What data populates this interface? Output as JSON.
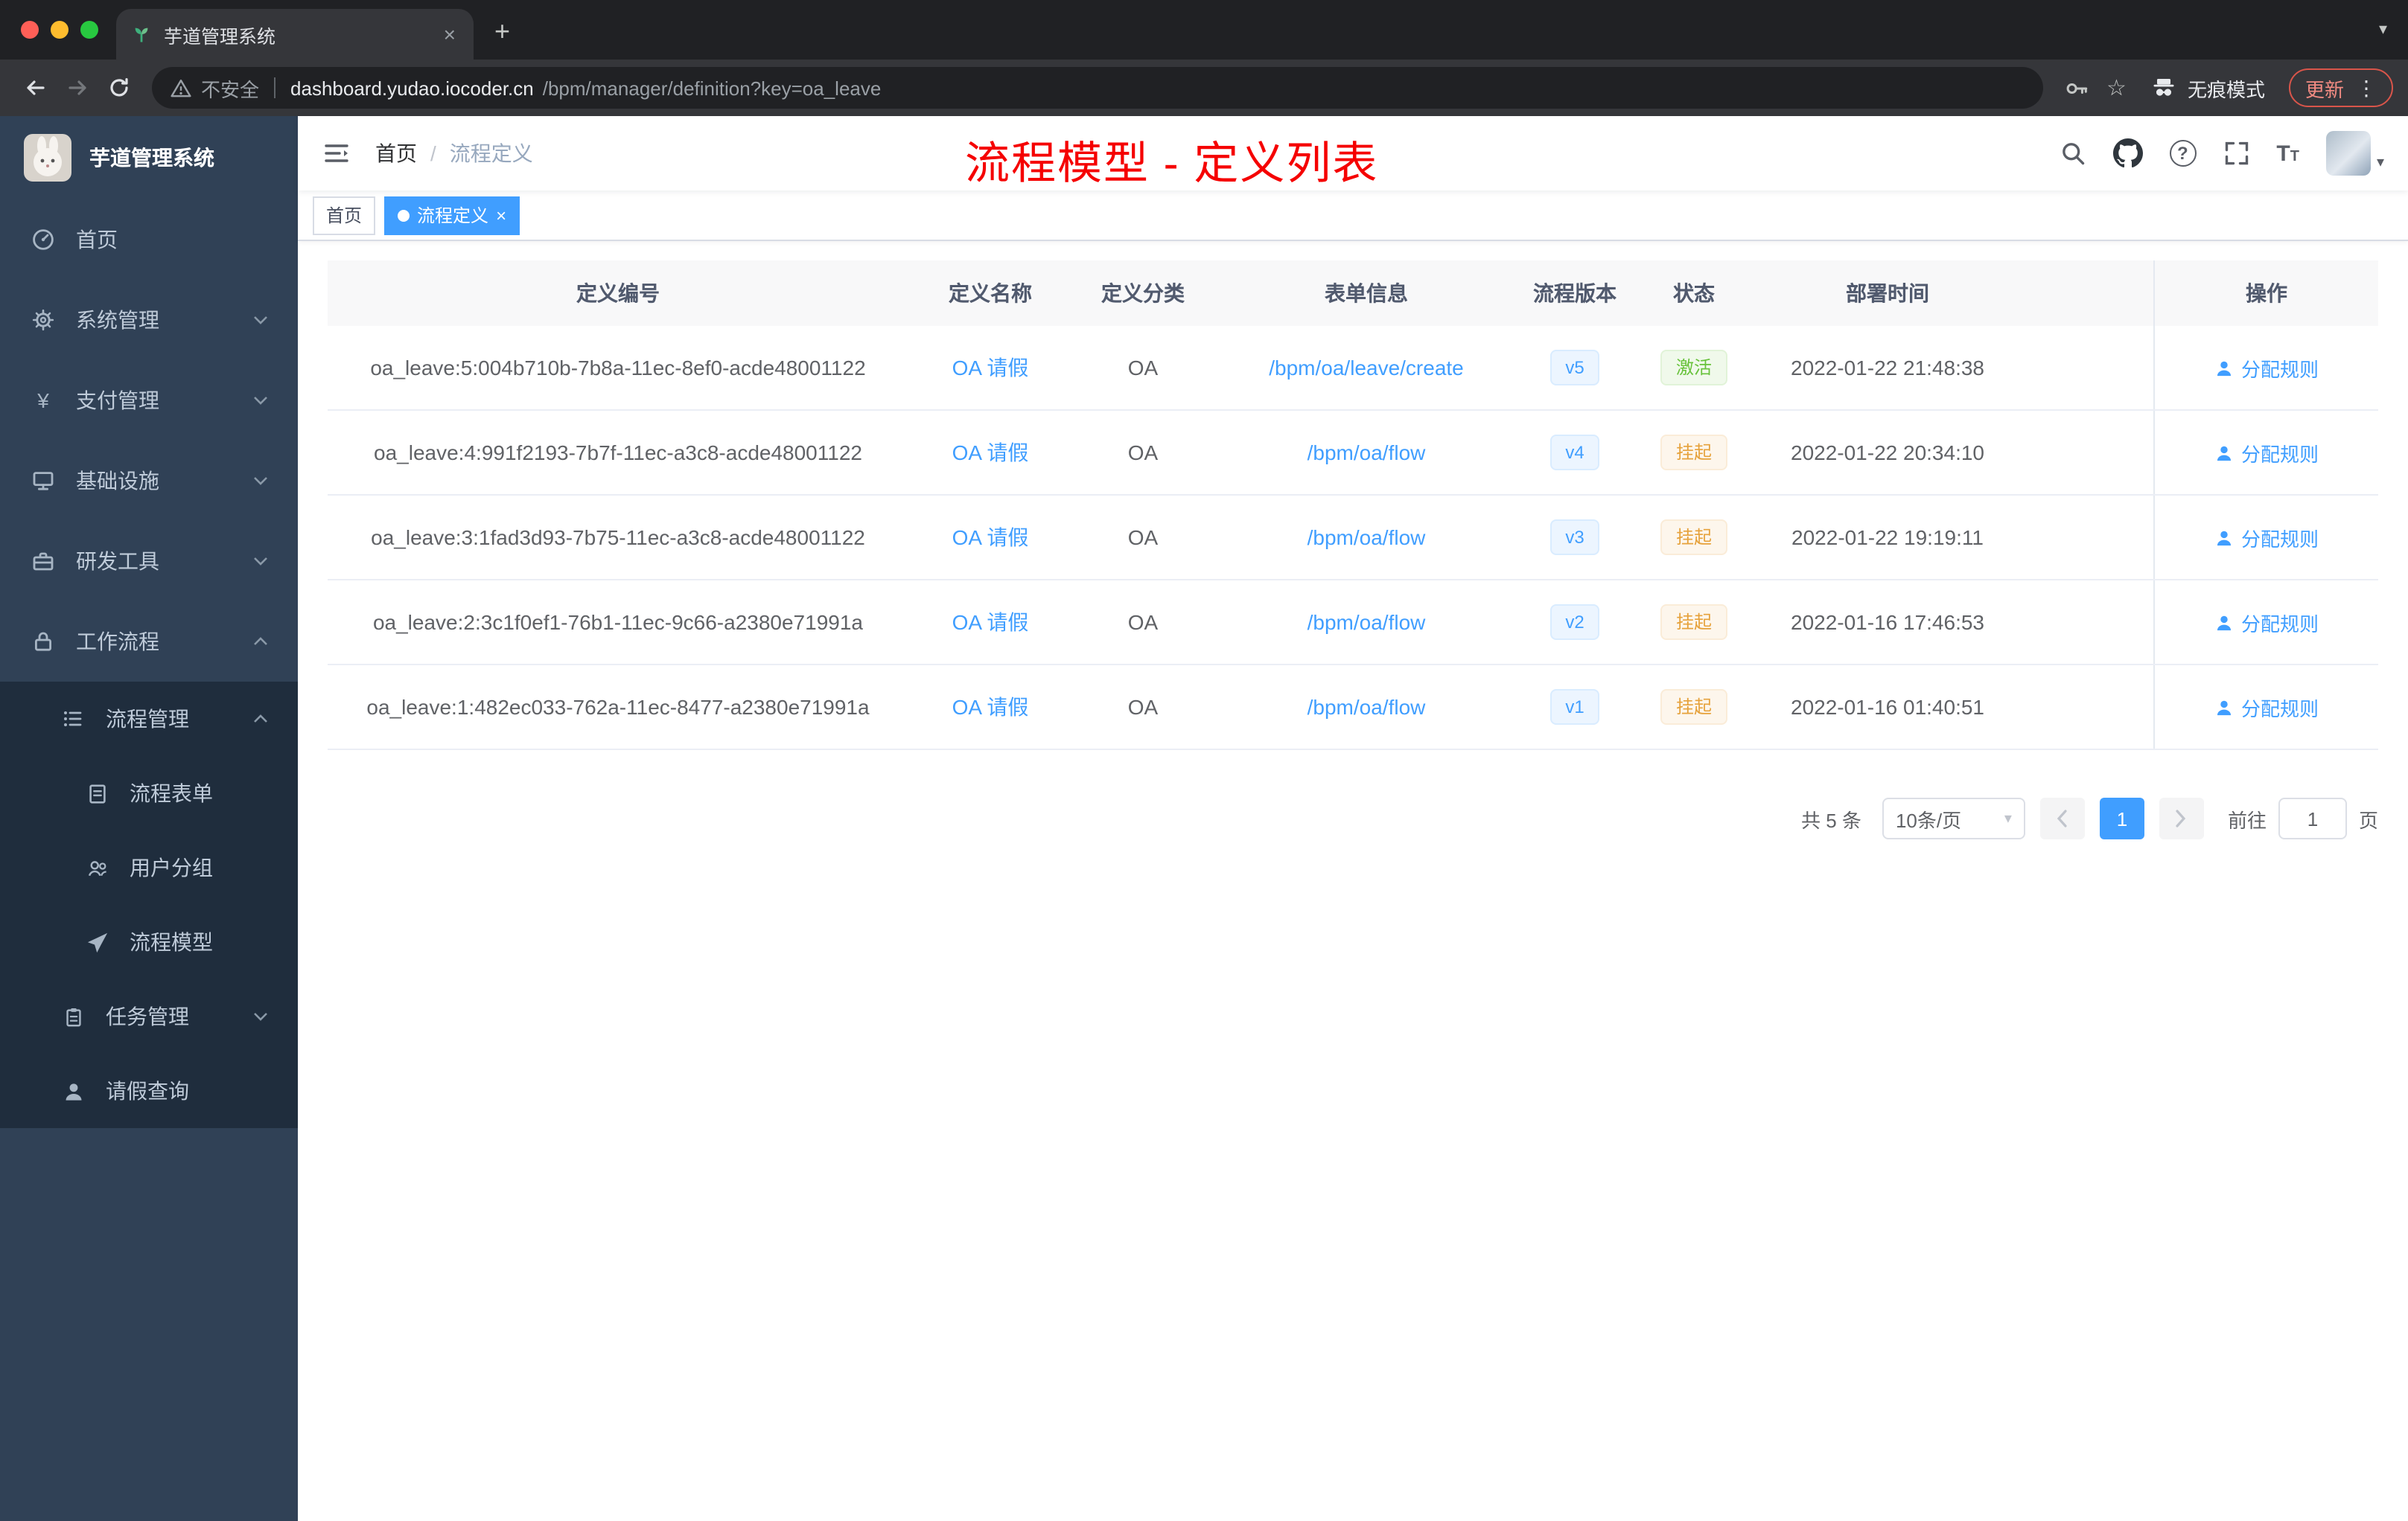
{
  "browser": {
    "tab_title": "芋道管理系统",
    "address": {
      "security_label": "不安全",
      "domain": "dashboard.yudao.iocoder.cn",
      "path": "/bpm/manager/definition?key=oa_leave"
    },
    "incognito_label": "无痕模式",
    "update_label": "更新"
  },
  "icons": {
    "new_tab": "+",
    "close_tab": "×",
    "tab_search": "▾",
    "star": "☆",
    "menu_dots": "⋮",
    "caret_down": "▾",
    "yen": "¥",
    "help": "?",
    "font_big": "T",
    "font_small": "T",
    "tag_close": "×"
  },
  "sidebar": {
    "logo_title": "芋道管理系统",
    "items": [
      {
        "label": "首页",
        "icon": "dashboard-icon"
      },
      {
        "label": "系统管理",
        "icon": "gear-icon",
        "state": "collapsed"
      },
      {
        "label": "支付管理",
        "icon": "yen-icon",
        "state": "collapsed"
      },
      {
        "label": "基础设施",
        "icon": "infrastructure-icon",
        "state": "collapsed"
      },
      {
        "label": "研发工具",
        "icon": "devtools-icon",
        "state": "collapsed"
      },
      {
        "label": "工作流程",
        "icon": "workflow-icon",
        "state": "expanded",
        "children": [
          {
            "label": "流程管理",
            "icon": "list-icon",
            "state": "expanded",
            "children": [
              {
                "label": "流程表单",
                "icon": "form-icon"
              },
              {
                "label": "用户分组",
                "icon": "user-group-icon"
              },
              {
                "label": "流程模型",
                "icon": "paper-plane-icon"
              }
            ]
          },
          {
            "label": "任务管理",
            "icon": "tasks-icon",
            "state": "collapsed"
          },
          {
            "label": "请假查询",
            "icon": "person-icon"
          }
        ]
      }
    ]
  },
  "header": {
    "breadcrumb": {
      "items": [
        "首页",
        "流程定义"
      ],
      "separator": "/"
    },
    "annotation": "流程模型 - 定义列表",
    "icons": [
      "search-icon",
      "github-icon",
      "help-icon",
      "fullscreen-icon",
      "font-size-icon",
      "avatar"
    ]
  },
  "tags_view": {
    "tags": [
      {
        "label": "首页",
        "active": false
      },
      {
        "label": "流程定义",
        "active": true
      }
    ]
  },
  "table": {
    "columns": [
      "定义编号",
      "定义名称",
      "定义分类",
      "表单信息",
      "流程版本",
      "状态",
      "部署时间",
      "操作"
    ],
    "action_label": "分配规则",
    "rows": [
      {
        "id": "oa_leave:5:004b710b-7b8a-11ec-8ef0-acde48001122",
        "name": "OA 请假",
        "category": "OA",
        "form": "/bpm/oa/leave/create",
        "version": "v5",
        "status": "激活",
        "status_type": "success",
        "deployed": "2022-01-22 21:48:38"
      },
      {
        "id": "oa_leave:4:991f2193-7b7f-11ec-a3c8-acde48001122",
        "name": "OA 请假",
        "category": "OA",
        "form": "/bpm/oa/flow",
        "version": "v4",
        "status": "挂起",
        "status_type": "warning",
        "deployed": "2022-01-22 20:34:10"
      },
      {
        "id": "oa_leave:3:1fad3d93-7b75-11ec-a3c8-acde48001122",
        "name": "OA 请假",
        "category": "OA",
        "form": "/bpm/oa/flow",
        "version": "v3",
        "status": "挂起",
        "status_type": "warning",
        "deployed": "2022-01-22 19:19:11"
      },
      {
        "id": "oa_leave:2:3c1f0ef1-76b1-11ec-9c66-a2380e71991a",
        "name": "OA 请假",
        "category": "OA",
        "form": "/bpm/oa/flow",
        "version": "v2",
        "status": "挂起",
        "status_type": "warning",
        "deployed": "2022-01-16 17:46:53"
      },
      {
        "id": "oa_leave:1:482ec033-762a-11ec-8477-a2380e71991a",
        "name": "OA 请假",
        "category": "OA",
        "form": "/bpm/oa/flow",
        "version": "v1",
        "status": "挂起",
        "status_type": "warning",
        "deployed": "2022-01-16 01:40:51"
      }
    ]
  },
  "pagination": {
    "total": "共 5 条",
    "page_size": "10条/页",
    "current_page": "1",
    "goto_label": "前往",
    "goto_value": "1",
    "unit_label": "页"
  },
  "colors": {
    "accent": "#409eff",
    "success": "#67c23a",
    "warning": "#e6a23c",
    "annotation_red": "#f50000",
    "sidebar_bg": "#304156",
    "submenu_bg": "#1f2d3d",
    "chrome_dark": "#202124",
    "chrome_toolbar": "#35363a"
  }
}
